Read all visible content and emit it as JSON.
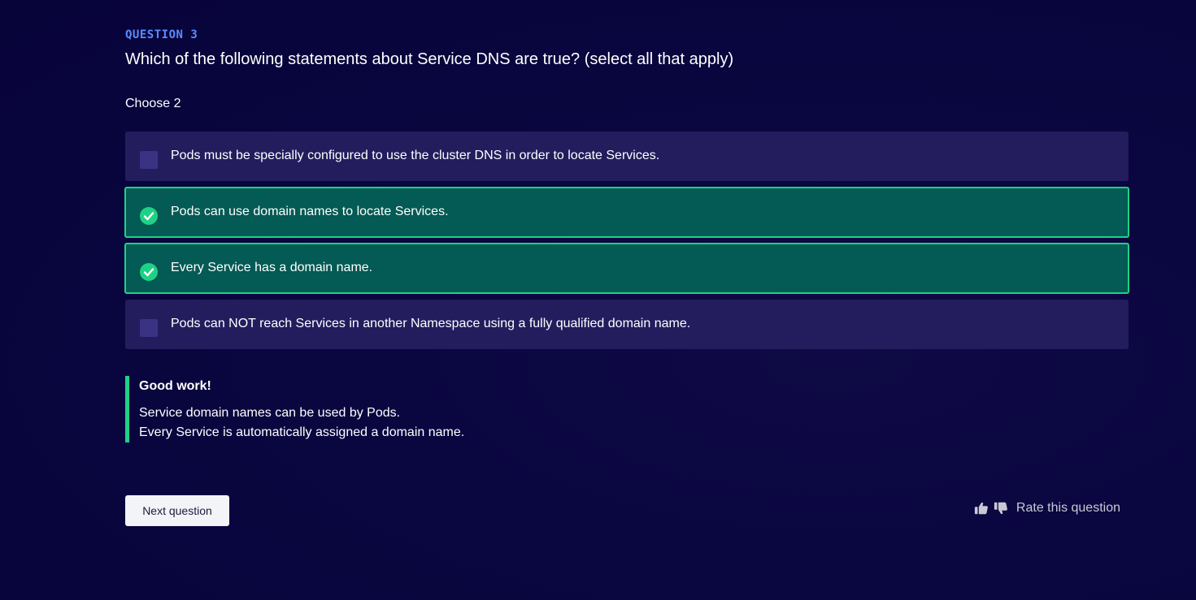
{
  "question": {
    "label": "QUESTION 3",
    "title": "Which of the following statements about Service DNS are true? (select all that apply)",
    "instruction": "Choose 2"
  },
  "options": [
    {
      "text": "Pods must be specially configured to use the cluster DNS in order to locate Services.",
      "selected": false,
      "correct": false
    },
    {
      "text": "Pods can use domain names to locate Services.",
      "selected": true,
      "correct": true
    },
    {
      "text": "Every Service has a domain name.",
      "selected": true,
      "correct": true
    },
    {
      "text": "Pods can NOT reach Services in another Namespace using a fully qualified domain name.",
      "selected": false,
      "correct": false
    }
  ],
  "feedback": {
    "title": "Good work!",
    "lines": [
      "Service domain names can be used by Pods.",
      "Every Service is automatically assigned a domain name."
    ]
  },
  "actions": {
    "next_label": "Next question",
    "rate_label": "Rate this question",
    "thumbs_up_icon": "thumbs-up-icon",
    "thumbs_down_icon": "thumbs-down-icon"
  },
  "colors": {
    "background": "#0a0640",
    "accent_label": "#5b8cff",
    "option_bg": "#231d5e",
    "option_correct_bg": "#045a54",
    "correct_green": "#1fd186"
  }
}
